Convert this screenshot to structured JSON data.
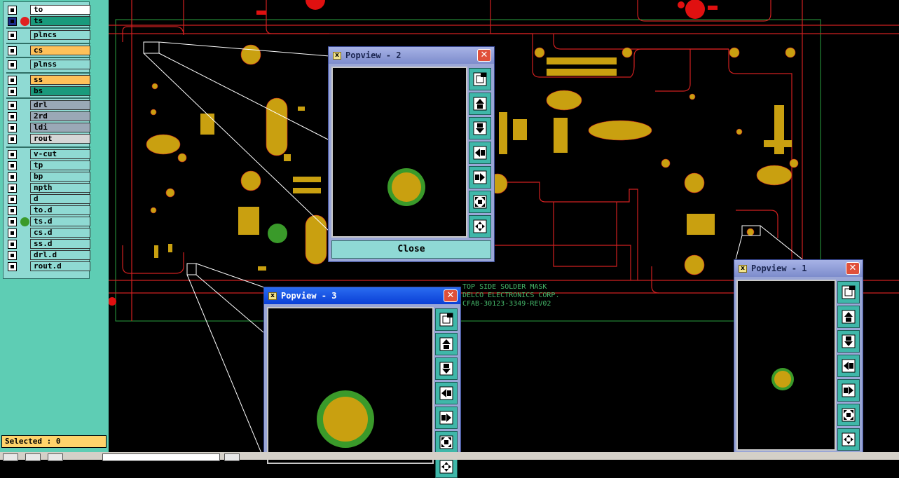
{
  "layers": [
    {
      "name": "to",
      "color": "#ffffff",
      "dot": null
    },
    {
      "name": "ts",
      "color": "#1a9a7c",
      "dot": "#e02020",
      "selected": true
    },
    {
      "name": "plncs",
      "color": "#8fdad3",
      "dot": null
    },
    {
      "name": "cs",
      "color": "#ffc15a",
      "dot": null
    },
    {
      "name": "plnss",
      "color": "#8fdad3",
      "dot": null
    },
    {
      "name": "ss",
      "color": "#ffc15a",
      "dot": null
    },
    {
      "name": "bs",
      "color": "#1a9a7c",
      "dot": null
    },
    {
      "name": "drl",
      "color": "#9aa8b6",
      "dot": null
    },
    {
      "name": "2rd",
      "color": "#9aa8b6",
      "dot": null
    },
    {
      "name": "ldi",
      "color": "#9aa8b6",
      "dot": null
    },
    {
      "name": "rout",
      "color": "#d6d6d6",
      "dot": null
    },
    {
      "name": "v-cut",
      "color": "#8fdad3",
      "dot": null
    },
    {
      "name": "tp",
      "color": "#8fdad3",
      "dot": null
    },
    {
      "name": "bp",
      "color": "#8fdad3",
      "dot": null
    },
    {
      "name": "npth",
      "color": "#8fdad3",
      "dot": null
    },
    {
      "name": "d",
      "color": "#8fdad3",
      "dot": null
    },
    {
      "name": "to.d",
      "color": "#8fdad3",
      "dot": null
    },
    {
      "name": "ts.d",
      "color": "#8fdad3",
      "dot": "#3a9a2a"
    },
    {
      "name": "cs.d",
      "color": "#8fdad3",
      "dot": null
    },
    {
      "name": "ss.d",
      "color": "#8fdad3",
      "dot": null
    },
    {
      "name": "drl.d",
      "color": "#8fdad3",
      "dot": null
    },
    {
      "name": "rout.d",
      "color": "#8fdad3",
      "dot": null
    }
  ],
  "status": {
    "selected": "Selected : 0"
  },
  "mask_label": {
    "line1": "TOP SIDE SOLDER MASK",
    "line2": "DELCO ELECTRONICS CORP.",
    "line3": "CFAB-30123-3349-REV02"
  },
  "popups": {
    "p2": {
      "title": "Popview - 2",
      "close": "Close"
    },
    "p3": {
      "title": "Popview - 3"
    },
    "p1": {
      "title": "Popview - 1"
    }
  },
  "colors": {
    "pad": "#c9a010",
    "ring": "#3a9a2a",
    "trace": "#d02020",
    "outline": "#2aa040"
  }
}
